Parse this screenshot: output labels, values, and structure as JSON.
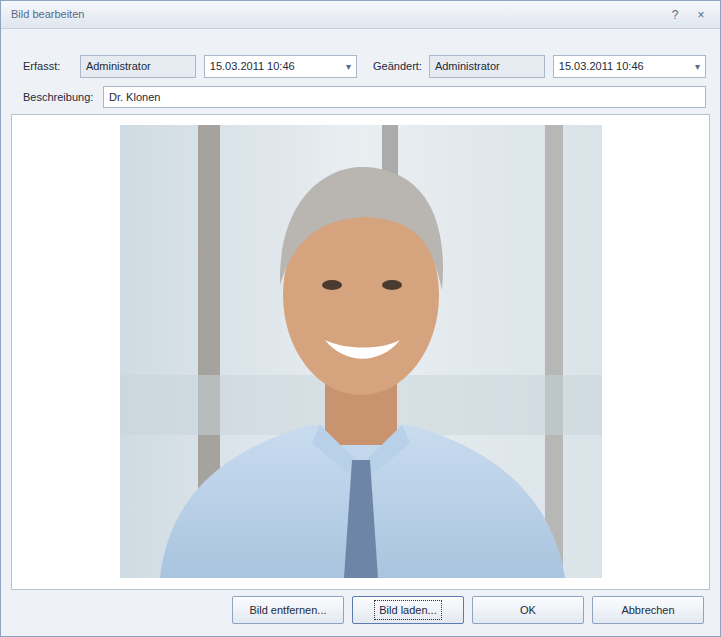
{
  "window": {
    "title": "Bild bearbeiten",
    "help": "?",
    "close": "×"
  },
  "created": {
    "label": "Erfasst:",
    "user": "Administrator",
    "date": "15.03.2011 10:46",
    "arrow": "▾"
  },
  "changed": {
    "label": "Geändert:",
    "user": "Administrator",
    "date": "15.03.2011 10:46",
    "arrow": "▾"
  },
  "description": {
    "label": "Beschreibung:",
    "value": "Dr. Klonen"
  },
  "buttons": [
    {
      "label": "Bild entfernen...",
      "focused": false
    },
    {
      "label": "Bild laden...",
      "focused": true
    },
    {
      "label": "OK",
      "focused": false
    },
    {
      "label": "Abbrechen",
      "focused": false
    }
  ]
}
